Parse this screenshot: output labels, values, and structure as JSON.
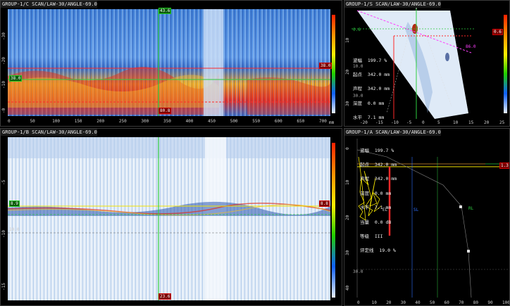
{
  "panels": {
    "cscan": {
      "title": "GROUP-1/C SCAN/LAW-30/ANGLE-69.0"
    },
    "sscan": {
      "title": "GROUP-1/S SCAN/LAW-30/ANGLE-69.0"
    },
    "bscan": {
      "title": "GROUP-1/B SCAN/LAW-30/ANGLE-69.0"
    },
    "ascan": {
      "title": "GROUP-1/A SCAN/LAW-30/ANGLE-69.0"
    }
  },
  "cscan_axis": {
    "unit": "mm",
    "x_ticks": [
      "0",
      "50",
      "100",
      "150",
      "200",
      "250",
      "300",
      "350",
      "400",
      "450",
      "500",
      "550",
      "600",
      "650",
      "700"
    ],
    "y_ticks": [
      "-30",
      "-20",
      "-10",
      "-0"
    ]
  },
  "bscan_axis": {
    "y_ticks": [
      "-5",
      "-10",
      "-15"
    ]
  },
  "cursor_labels": {
    "c_top": "43.6",
    "c_left": "38.0",
    "c_right": "38.0",
    "c_bottom": "80.8",
    "b_left": "8.9",
    "b_left2": "10.0",
    "b_right": "8.8",
    "b_bottom": "23.6",
    "s_dist": "86.0",
    "s_left": "0.6",
    "s_right": "0.6",
    "s_left2": "10.0",
    "s_left3": "30.0",
    "a_right": "1.3",
    "a_left": "30.0",
    "a_el": "EL",
    "a_sl": "SL",
    "a_rl": "RL"
  },
  "sscan_axis": {
    "x_ticks": [
      "-20",
      "-15",
      "-10",
      "-5",
      "0",
      "5",
      "10",
      "15",
      "20",
      "25"
    ],
    "y_ticks": [
      "10",
      "20",
      "30"
    ]
  },
  "ascan_axis": {
    "x_ticks": [
      "0",
      "10",
      "20",
      "30",
      "40",
      "50",
      "60",
      "70",
      "80",
      "90",
      "100"
    ],
    "y_ticks": [
      "0",
      "10",
      "20",
      "30",
      "40"
    ]
  },
  "info_block": {
    "lines": [
      "波幅  199.7 %",
      "起点  342.0 mm",
      "声程  342.0 mm",
      "深度  0.0 mm",
      "水平  7.1 mm",
      "当量  0.0 dB",
      "等级  III",
      "评定线  19.0 %"
    ]
  },
  "colors": {
    "panel_border": "#3a3a3a",
    "cursor_green": "#2ecc40",
    "cursor_red": "#ff2a2a",
    "gate_yellow": "#f2e200",
    "magenta": "#ff40ff"
  }
}
